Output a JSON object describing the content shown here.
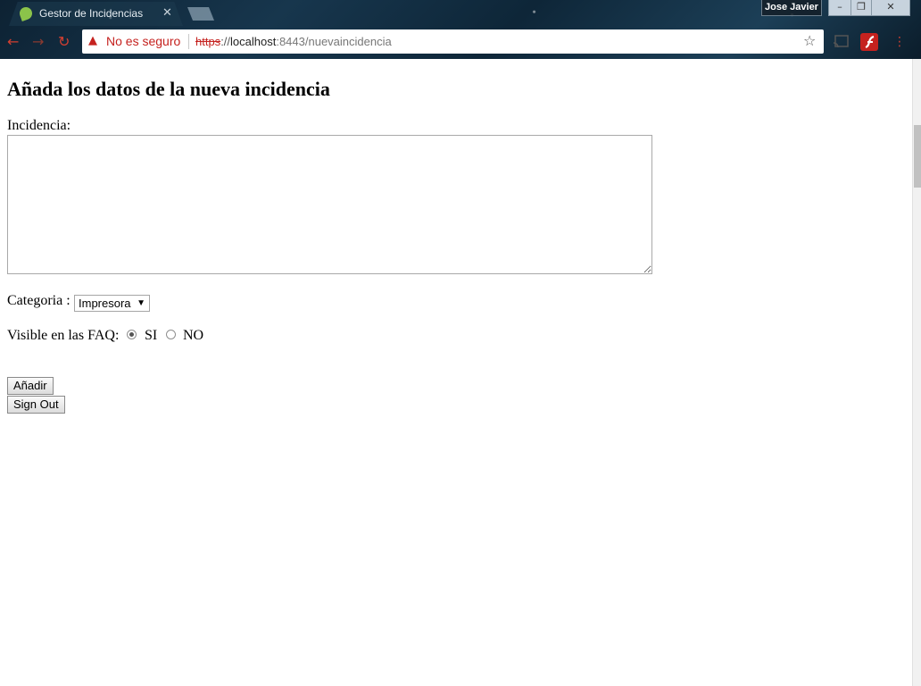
{
  "browser": {
    "tab_title": "Gestor de Incidencias",
    "tab_close_icon": "close-icon",
    "profile_name": "Jose Javier",
    "security_label": "No es seguro",
    "url_scheme": "https",
    "url_separator": "://",
    "url_host": "localhost",
    "url_path": ":8443/nuevaincidencia",
    "icons": {
      "back": "back-arrow-icon",
      "forward": "forward-arrow-icon",
      "reload": "reload-icon",
      "warning": "warning-icon",
      "bookmark": "star-icon",
      "cast": "cast-icon",
      "flash": "flash-icon",
      "menu": "menu-icon"
    },
    "colors": {
      "insecure": "#c5221f",
      "icon_red": "#d23f31"
    }
  },
  "page": {
    "heading": "Añada los datos de la nueva incidencia",
    "incidencia_label": "Incidencia:",
    "incidencia_value": "",
    "categoria_label": "Categoria :",
    "categoria_selected": "Impresora",
    "faq_label": "Visible en las FAQ:",
    "faq_options": [
      {
        "label": "SI",
        "checked": true
      },
      {
        "label": "NO",
        "checked": false
      }
    ],
    "add_button": "Añadir",
    "signout_button": "Sign Out"
  }
}
